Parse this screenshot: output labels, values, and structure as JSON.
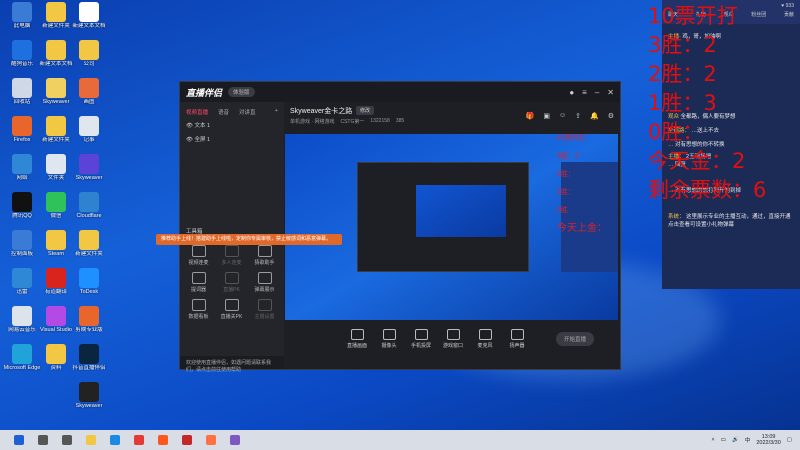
{
  "desktop": {
    "col1": [
      {
        "label": "此电脑",
        "icon": "computer-icon",
        "color": "#3a7bd5"
      },
      {
        "label": "酷狗音乐",
        "icon": "kugou-icon",
        "color": "#1e6fe0"
      },
      {
        "label": "回收站",
        "icon": "recycle-bin-icon",
        "color": "#cfd8e6"
      },
      {
        "label": "Firefox",
        "icon": "firefox-icon",
        "color": "#e8652b"
      },
      {
        "label": "网络",
        "icon": "network-icon",
        "color": "#2f88d6"
      },
      {
        "label": "腾讯QQ",
        "icon": "qq-icon",
        "color": "#111111"
      },
      {
        "label": "控制面板",
        "icon": "control-panel-icon",
        "color": "#3a7bd5"
      },
      {
        "label": "迅雷",
        "icon": "xunlei-icon",
        "color": "#2f88d6"
      },
      {
        "label": "网易云音乐",
        "icon": "music-icon",
        "color": "#dde3ea"
      },
      {
        "label": "Microsoft Edge",
        "icon": "edge-icon",
        "color": "#1fa3d8"
      }
    ],
    "col2": [
      {
        "label": "新建文件夹",
        "icon": "folder-icon",
        "color": "#f2c744"
      },
      {
        "label": "新建文本文档",
        "icon": "text-file-icon",
        "color": "#f2c744"
      },
      {
        "label": "Skyweaver",
        "icon": "exe-icon",
        "color": "#f0d060"
      },
      {
        "label": "新建文件夹",
        "icon": "folder-icon",
        "color": "#f2c744"
      },
      {
        "label": "文件夹",
        "icon": "folder-icon",
        "color": "#dfe6f0"
      },
      {
        "label": "微信",
        "icon": "wechat-icon",
        "color": "#2fc25b"
      },
      {
        "label": "Steam",
        "icon": "steam-icon",
        "color": "#f2c744"
      },
      {
        "label": "有道翻译",
        "icon": "youdao-icon",
        "color": "#d8241c"
      },
      {
        "label": "Visual Studio",
        "icon": "vs-icon",
        "color": "#b44ae6"
      },
      {
        "label": "资料",
        "icon": "folder-icon",
        "color": "#f2c744"
      }
    ],
    "col3": [
      {
        "label": "新建文本文档",
        "icon": "text-file-icon",
        "color": "#ffffff"
      },
      {
        "label": "公司",
        "icon": "folder-icon",
        "color": "#f2c744"
      },
      {
        "label": "画图",
        "icon": "paint-icon",
        "color": "#e86a3a"
      },
      {
        "label": "记事",
        "icon": "notes-icon",
        "color": "#e0e6ee"
      },
      {
        "label": "Skyweaver",
        "icon": "skyweaver-icon",
        "color": "#5b43d8"
      },
      {
        "label": "Cloudflare",
        "icon": "globe-icon",
        "color": "#2e82d0"
      },
      {
        "label": "新建文件夹",
        "icon": "folder-icon",
        "color": "#f2c744"
      },
      {
        "label": "ToDesk",
        "icon": "todesk-icon",
        "color": "#1e90ff"
      },
      {
        "label": "剪映专业版",
        "icon": "cut-icon",
        "color": "#e8652b"
      },
      {
        "label": "抖音直播伴侣",
        "icon": "obs-icon",
        "color": "#0a2540"
      },
      {
        "label": "Skyweaver",
        "icon": "game-icon",
        "color": "#222222"
      }
    ],
    "widget_text": "2022"
  },
  "app": {
    "logo": "直播伴侣",
    "badge": "体验版",
    "left_tabs": [
      "视频直播",
      "语音",
      "对讲直"
    ],
    "scenes": [
      "文本 1",
      "全屏 1"
    ],
    "tools_title": "工具箱",
    "tools": [
      {
        "label": "视频连麦",
        "dim": false
      },
      {
        "label": "多人连麦",
        "dim": true
      },
      {
        "label": "猜歌助手",
        "dim": false
      },
      {
        "label": "提词器",
        "dim": false
      },
      {
        "label": "直播PK",
        "dim": true
      },
      {
        "label": "弹幕展示",
        "dim": false
      },
      {
        "label": "数据看板",
        "dim": false
      },
      {
        "label": "直播关PK",
        "dim": false
      },
      {
        "label": "主题设置",
        "dim": true
      }
    ],
    "banner": "推荐助手上线！搭建助手上线啦，定制你专属审核，禁止敏感词和恶意弹幕。",
    "status": "欢迎使用直播伴侣，如遇问题请联系我们，请点击前往使用帮助",
    "stream_title": "Skyweaver金卡之路",
    "edit_label": "修改",
    "sub_items": [
      "单机游戏 · 网络游戏",
      "CSTG第一",
      "1322158",
      "385"
    ],
    "bottom_buttons": [
      "直播画面",
      "摄像头",
      "手机投屏",
      "游戏窗口",
      "麦克风",
      "扬声器"
    ],
    "start_label": "开始直播"
  },
  "preview_text": [
    "10票开打",
    "3胜：2",
    "2胜：",
    "1胜：",
    "0胜",
    "今天上金："
  ],
  "chat": {
    "tabs": [
      "聊天",
      "礼物",
      "观众",
      "粉丝团",
      "贡献"
    ],
    "viewers": "933",
    "messages": [
      {
        "name": "主播·",
        "text": "鸡，哥，加油啊"
      },
      {
        "name": "观众",
        "text": "全都路，偶人要有梦想"
      },
      {
        "name": "全都路：",
        "text": "…送上不去"
      },
      {
        "name": "…",
        "text": "对有思想的你不转换"
      },
      {
        "name": "主播：",
        "text": "2王现场吧"
      },
      {
        "name": "…",
        "text": "回复"
      },
      {
        "name": "…",
        "text": "对有思想的想打到开的到掉"
      },
      {
        "name": "系统：",
        "text": "这里展示专业的主播互动，通过，直接开通"
      },
      {
        "name": "",
        "text": "点击查看可设置小礼物弹幕"
      }
    ]
  },
  "overlay": [
    "10票开打",
    "3胜：2",
    "2胜：2",
    "1胜：3",
    "0胜：",
    "今天金：2",
    "剩余票数：6"
  ],
  "taskbar": {
    "time": "13:09",
    "date": "2022/3/30",
    "lang": "中",
    "icons": [
      "windows-icon",
      "search-icon",
      "taskview-icon",
      "explorer-icon",
      "browser-icon",
      "chrome-icon",
      "app-icon",
      "app2-icon",
      "qq-icon",
      "live-icon"
    ]
  }
}
